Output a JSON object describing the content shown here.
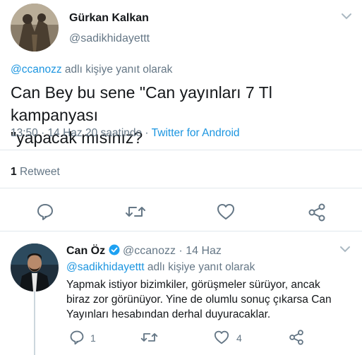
{
  "tweet": {
    "author_name": "Gürkan Kalkan",
    "author_handle": "@sadikhidayettt",
    "reply_to_mention": "@ccanozz",
    "reply_to_suffix": "adlı kişiye yanıt olarak",
    "text_line1": "Can Bey bu sene \"Can yayınları 7 Tl kampanyası",
    "text_line2": "\"yapacak mısınız?",
    "time": "13:50 · 14 Haz 20 saatinde ·",
    "source": "Twitter for Android",
    "retweet_count": "1",
    "retweet_label": "Retweet"
  },
  "reply": {
    "author_name": "Can Öz",
    "author_handle": "@ccanozz",
    "date": "· 14 Haz",
    "reply_to_mention": "@sadikhidayettt",
    "reply_to_suffix": "adlı kişiye yanıt olarak",
    "line1": "Yapmak istiyor bizimkiler, görüşmeler sürüyor, ancak",
    "line2": "biraz zor görünüyor. Yine de olumlu sonuç çıkarsa Can",
    "line3": "Yayınları hesabından derhal duyuracaklar.",
    "reply_count": "1",
    "like_count": "4"
  },
  "colors": {
    "link": "#1b95e0",
    "muted": "#657786",
    "verified": "#1da1f2"
  }
}
